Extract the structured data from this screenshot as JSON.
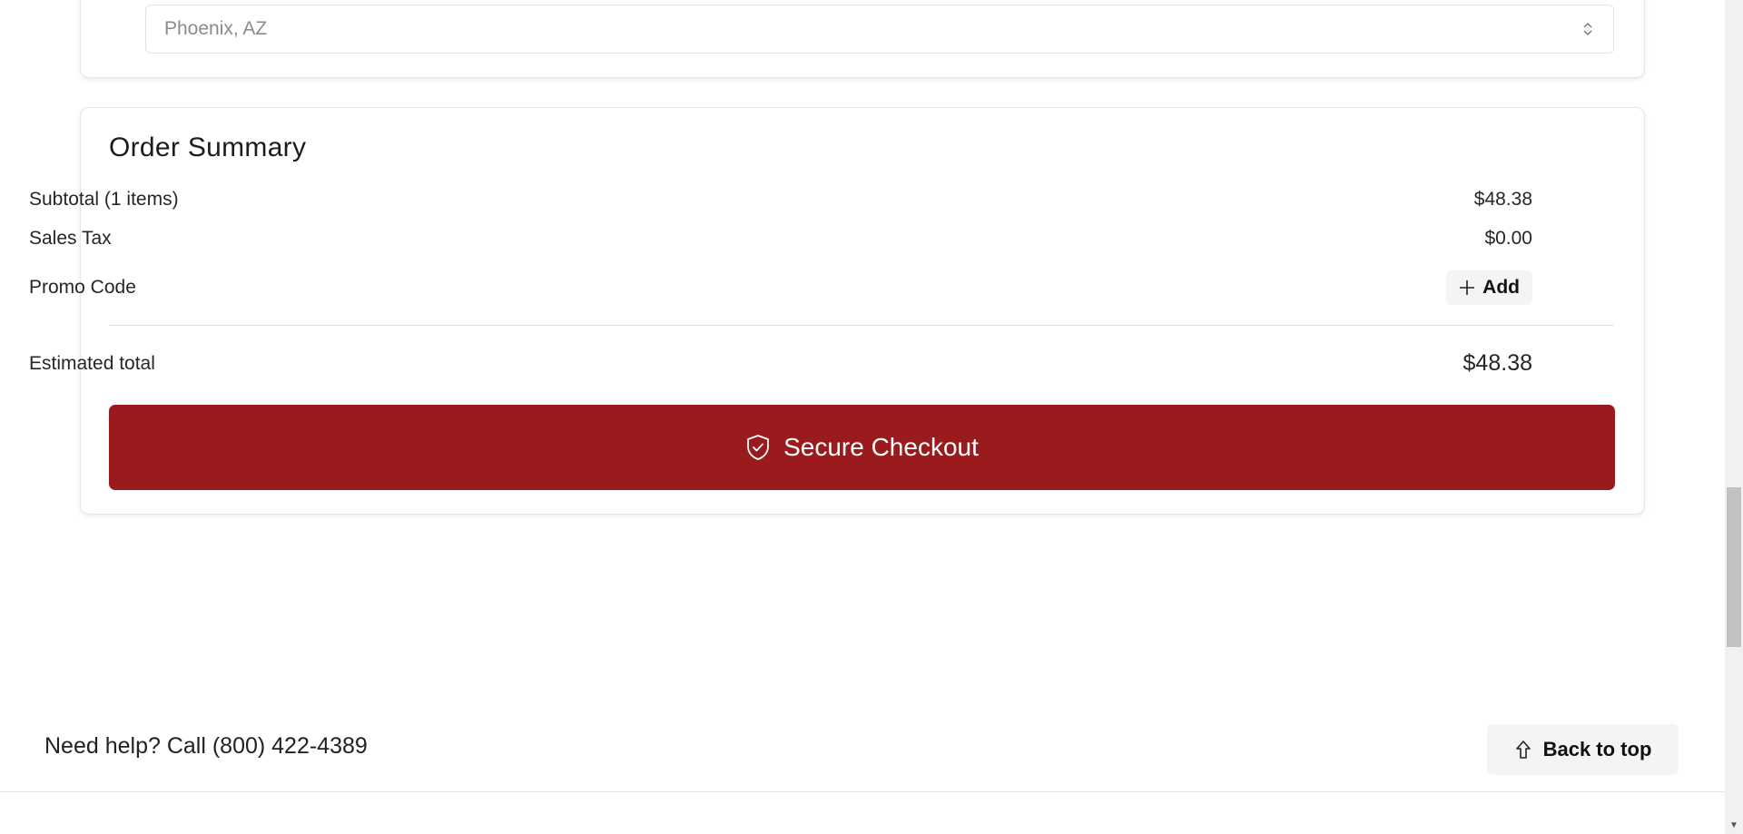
{
  "store_select": {
    "value": "Phoenix, AZ",
    "icon": "chevron-updown-icon"
  },
  "order_summary": {
    "title": "Order Summary",
    "subtotal_label": "Subtotal (1 items)",
    "subtotal_value": "$48.38",
    "tax_label": "Sales Tax",
    "tax_value": "$0.00",
    "promo_label": "Promo Code",
    "add_label": "Add",
    "total_label": "Estimated total",
    "total_value": "$48.38",
    "checkout_label": "Secure Checkout",
    "checkout_color": "#991b1e"
  },
  "footer": {
    "help_text": "Need help? Call (800) 422-4389",
    "back_to_top_label": "Back to top"
  }
}
